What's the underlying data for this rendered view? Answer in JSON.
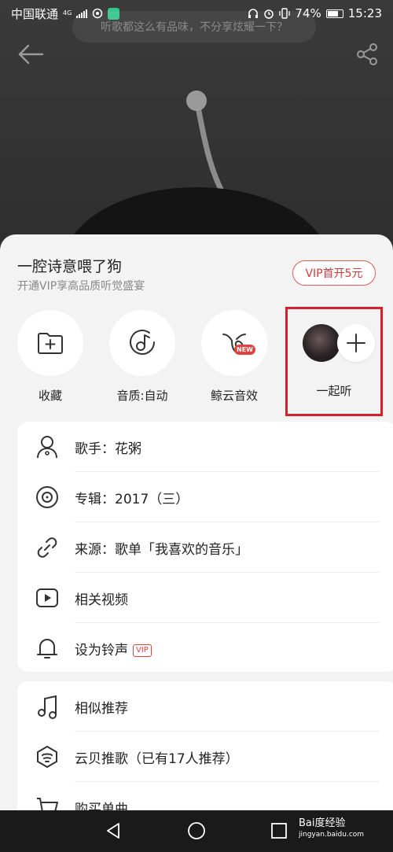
{
  "status_bar": {
    "carrier": "中国联通",
    "network": "4G",
    "battery": "74%",
    "battery_level": 0.74,
    "time": "15:23"
  },
  "player": {
    "tip": "听歌都这么有品味，不分享炫耀一下？"
  },
  "sheet": {
    "title": "一腔诗意喂了狗",
    "subtitle": "开通VIP享高品质听觉盛宴",
    "vip_button": "VIP首开5元",
    "actions": [
      {
        "label": "收藏",
        "icon": "add-folder-icon"
      },
      {
        "label": "音质:自动",
        "icon": "music-quality-icon"
      },
      {
        "label": "鲸云音效",
        "icon": "whale-effect-icon",
        "badge": "NEW"
      },
      {
        "label": "一起听",
        "icon": "plus-icon"
      }
    ],
    "menu1": [
      {
        "label": "歌手：花粥",
        "icon": "singer-icon"
      },
      {
        "label": "专辑：2017（三）",
        "icon": "album-icon"
      },
      {
        "label": "来源：歌单「我喜欢的音乐」",
        "icon": "link-icon"
      },
      {
        "label": "相关视频",
        "icon": "video-play-icon"
      },
      {
        "label": "设为铃声",
        "icon": "bell-icon",
        "tag": "VIP"
      }
    ],
    "menu2": [
      {
        "label": "相似推荐",
        "icon": "music-note-icon"
      },
      {
        "label": "云贝推歌（已有17人推荐）",
        "icon": "cloud-coin-icon"
      },
      {
        "label": "购买单曲",
        "icon": "cart-icon"
      }
    ]
  },
  "watermark": {
    "brand": "Bai度经验",
    "url": "jingyan.baidu.com"
  },
  "colors": {
    "accent": "#d33a3a",
    "highlight_box": "#d7202a"
  }
}
